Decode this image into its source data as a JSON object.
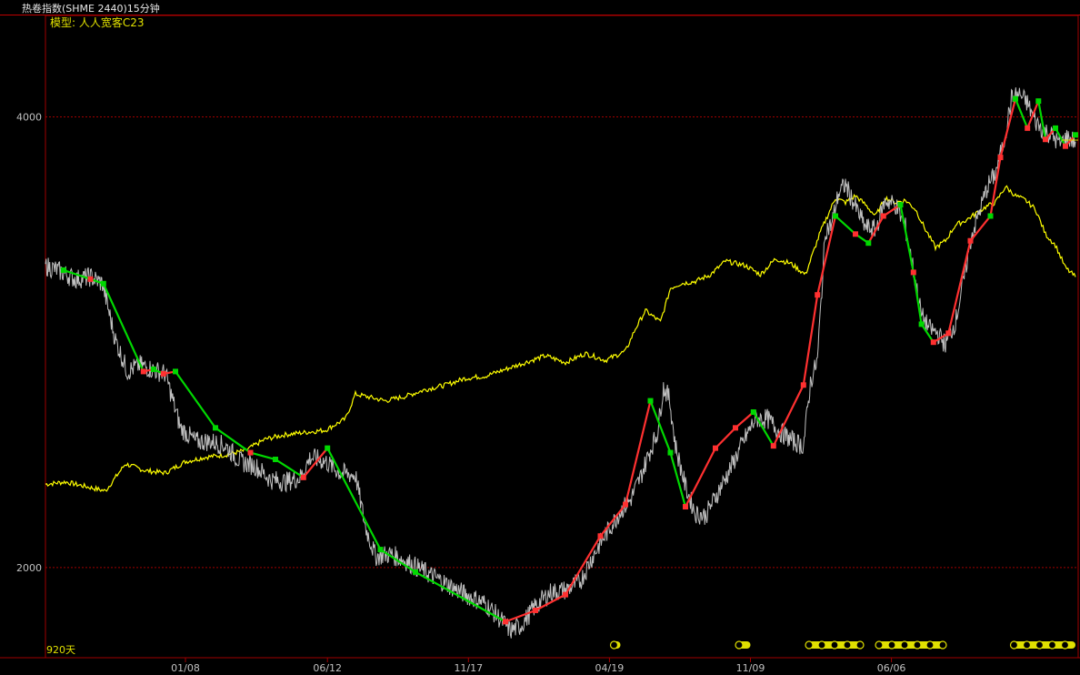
{
  "window": {
    "title": "热卷指数(SHME 2440)15分钟"
  },
  "model_label": "模型: 人人宽客C23",
  "period_label": "920天",
  "colors": {
    "price": "#c0c0c0",
    "equity": "#ffff00",
    "up_segment": "#ff3030",
    "down_segment": "#00d800",
    "grid": "#a00000",
    "axis_text": "#c0c0c0",
    "marker_fill": "#e0e000"
  },
  "chart_data": {
    "type": "line",
    "x_tick_labels": [
      "01/08",
      "06/12",
      "11/17",
      "04/19",
      "11/09",
      "06/06"
    ],
    "y_ticks": [
      4000,
      2000
    ],
    "ylim": [
      1600,
      4450
    ],
    "grid": true,
    "series": [
      {
        "role": "price",
        "points": [
          [
            0.0,
            3340
          ],
          [
            0.012,
            3320
          ],
          [
            0.03,
            3280
          ],
          [
            0.045,
            3290
          ],
          [
            0.057,
            3260
          ],
          [
            0.07,
            3010
          ],
          [
            0.082,
            2870
          ],
          [
            0.094,
            2900
          ],
          [
            0.106,
            2880
          ],
          [
            0.12,
            2860
          ],
          [
            0.135,
            2620
          ],
          [
            0.15,
            2560
          ],
          [
            0.165,
            2560
          ],
          [
            0.18,
            2540
          ],
          [
            0.195,
            2470
          ],
          [
            0.21,
            2450
          ],
          [
            0.225,
            2390
          ],
          [
            0.24,
            2380
          ],
          [
            0.255,
            2400
          ],
          [
            0.265,
            2490
          ],
          [
            0.28,
            2470
          ],
          [
            0.295,
            2420
          ],
          [
            0.31,
            2410
          ],
          [
            0.32,
            2180
          ],
          [
            0.33,
            2050
          ],
          [
            0.345,
            2060
          ],
          [
            0.36,
            2030
          ],
          [
            0.38,
            1980
          ],
          [
            0.4,
            1930
          ],
          [
            0.42,
            1880
          ],
          [
            0.44,
            1840
          ],
          [
            0.455,
            1770
          ],
          [
            0.465,
            1720
          ],
          [
            0.475,
            1740
          ],
          [
            0.49,
            1830
          ],
          [
            0.505,
            1890
          ],
          [
            0.52,
            1900
          ],
          [
            0.535,
            1940
          ],
          [
            0.545,
            2030
          ],
          [
            0.555,
            2110
          ],
          [
            0.565,
            2180
          ],
          [
            0.575,
            2250
          ],
          [
            0.585,
            2300
          ],
          [
            0.595,
            2400
          ],
          [
            0.603,
            2500
          ],
          [
            0.612,
            2600
          ],
          [
            0.618,
            2800
          ],
          [
            0.624,
            2750
          ],
          [
            0.63,
            2540
          ],
          [
            0.64,
            2360
          ],
          [
            0.65,
            2240
          ],
          [
            0.66,
            2230
          ],
          [
            0.672,
            2330
          ],
          [
            0.685,
            2440
          ],
          [
            0.698,
            2560
          ],
          [
            0.71,
            2660
          ],
          [
            0.722,
            2660
          ],
          [
            0.735,
            2600
          ],
          [
            0.748,
            2560
          ],
          [
            0.758,
            2540
          ],
          [
            0.765,
            2820
          ],
          [
            0.772,
            2920
          ],
          [
            0.78,
            3500
          ],
          [
            0.786,
            3520
          ],
          [
            0.793,
            3660
          ],
          [
            0.8,
            3700
          ],
          [
            0.81,
            3600
          ],
          [
            0.82,
            3510
          ],
          [
            0.83,
            3500
          ],
          [
            0.84,
            3630
          ],
          [
            0.85,
            3610
          ],
          [
            0.86,
            3510
          ],
          [
            0.868,
            3320
          ],
          [
            0.876,
            3120
          ],
          [
            0.884,
            3060
          ],
          [
            0.892,
            3040
          ],
          [
            0.9,
            2990
          ],
          [
            0.91,
            3090
          ],
          [
            0.918,
            3270
          ],
          [
            0.926,
            3470
          ],
          [
            0.934,
            3580
          ],
          [
            0.942,
            3690
          ],
          [
            0.95,
            3750
          ],
          [
            0.958,
            3880
          ],
          [
            0.966,
            4080
          ],
          [
            0.974,
            4100
          ],
          [
            0.982,
            4060
          ],
          [
            0.99,
            3980
          ],
          [
            0.998,
            3940
          ],
          [
            1.006,
            3920
          ],
          [
            1.014,
            3880
          ],
          [
            1.022,
            3910
          ],
          [
            1.03,
            3890
          ]
        ]
      },
      {
        "role": "equity",
        "points": [
          [
            0.0,
            2370
          ],
          [
            0.02,
            2380
          ],
          [
            0.04,
            2360
          ],
          [
            0.06,
            2340
          ],
          [
            0.08,
            2460
          ],
          [
            0.1,
            2430
          ],
          [
            0.12,
            2420
          ],
          [
            0.14,
            2470
          ],
          [
            0.16,
            2490
          ],
          [
            0.18,
            2500
          ],
          [
            0.2,
            2520
          ],
          [
            0.22,
            2570
          ],
          [
            0.24,
            2590
          ],
          [
            0.26,
            2600
          ],
          [
            0.28,
            2610
          ],
          [
            0.3,
            2660
          ],
          [
            0.31,
            2770
          ],
          [
            0.32,
            2760
          ],
          [
            0.34,
            2740
          ],
          [
            0.36,
            2760
          ],
          [
            0.38,
            2790
          ],
          [
            0.4,
            2810
          ],
          [
            0.42,
            2840
          ],
          [
            0.44,
            2850
          ],
          [
            0.46,
            2880
          ],
          [
            0.48,
            2910
          ],
          [
            0.5,
            2940
          ],
          [
            0.52,
            2910
          ],
          [
            0.54,
            2950
          ],
          [
            0.56,
            2920
          ],
          [
            0.58,
            2960
          ],
          [
            0.59,
            3060
          ],
          [
            0.6,
            3140
          ],
          [
            0.615,
            3090
          ],
          [
            0.625,
            3240
          ],
          [
            0.635,
            3260
          ],
          [
            0.65,
            3270
          ],
          [
            0.665,
            3300
          ],
          [
            0.68,
            3360
          ],
          [
            0.7,
            3340
          ],
          [
            0.715,
            3300
          ],
          [
            0.73,
            3370
          ],
          [
            0.745,
            3350
          ],
          [
            0.76,
            3300
          ],
          [
            0.775,
            3490
          ],
          [
            0.79,
            3640
          ],
          [
            0.8,
            3620
          ],
          [
            0.81,
            3650
          ],
          [
            0.82,
            3610
          ],
          [
            0.83,
            3560
          ],
          [
            0.84,
            3640
          ],
          [
            0.85,
            3620
          ],
          [
            0.86,
            3630
          ],
          [
            0.87,
            3590
          ],
          [
            0.88,
            3500
          ],
          [
            0.89,
            3420
          ],
          [
            0.9,
            3450
          ],
          [
            0.91,
            3520
          ],
          [
            0.92,
            3540
          ],
          [
            0.93,
            3570
          ],
          [
            0.94,
            3600
          ],
          [
            0.95,
            3620
          ],
          [
            0.96,
            3690
          ],
          [
            0.97,
            3650
          ],
          [
            0.98,
            3630
          ],
          [
            0.99,
            3590
          ],
          [
            1.0,
            3480
          ],
          [
            1.01,
            3430
          ],
          [
            1.02,
            3330
          ],
          [
            1.03,
            3290
          ]
        ]
      },
      {
        "role": "signal_segments",
        "points": [
          [
            0.018,
            3320,
            "d"
          ],
          [
            0.045,
            3280,
            "u"
          ],
          [
            0.058,
            3260,
            "d"
          ],
          [
            0.098,
            2870,
            "u"
          ],
          [
            0.108,
            2880,
            "d"
          ],
          [
            0.118,
            2860,
            "u"
          ],
          [
            0.13,
            2870,
            "d"
          ],
          [
            0.17,
            2620,
            "d"
          ],
          [
            0.205,
            2510,
            "u"
          ],
          [
            0.23,
            2480,
            "d"
          ],
          [
            0.258,
            2400,
            "u"
          ],
          [
            0.282,
            2530,
            "d"
          ],
          [
            0.335,
            2080,
            "d"
          ],
          [
            0.37,
            1980,
            "d"
          ],
          [
            0.46,
            1760,
            "u"
          ],
          [
            0.49,
            1810,
            "u"
          ],
          [
            0.52,
            1880,
            "u"
          ],
          [
            0.555,
            2140,
            "u"
          ],
          [
            0.58,
            2280,
            "u"
          ],
          [
            0.605,
            2740,
            "d"
          ],
          [
            0.625,
            2510,
            "d"
          ],
          [
            0.64,
            2270,
            "u"
          ],
          [
            0.67,
            2530,
            "u"
          ],
          [
            0.69,
            2620,
            "u"
          ],
          [
            0.708,
            2690,
            "d"
          ],
          [
            0.728,
            2540,
            "u"
          ],
          [
            0.758,
            2810,
            "u"
          ],
          [
            0.772,
            3210,
            "u"
          ],
          [
            0.79,
            3560,
            "d"
          ],
          [
            0.81,
            3480,
            "u"
          ],
          [
            0.823,
            3440,
            "d"
          ],
          [
            0.838,
            3560,
            "u"
          ],
          [
            0.855,
            3610,
            "d"
          ],
          [
            0.868,
            3310,
            "u"
          ],
          [
            0.876,
            3080,
            "d"
          ],
          [
            0.888,
            3000,
            "u"
          ],
          [
            0.903,
            3040,
            "u"
          ],
          [
            0.925,
            3450,
            "u"
          ],
          [
            0.945,
            3560,
            "d"
          ],
          [
            0.955,
            3820,
            "u"
          ],
          [
            0.97,
            4080,
            "d"
          ],
          [
            0.982,
            3950,
            "u"
          ],
          [
            0.993,
            4070,
            "d"
          ],
          [
            1.0,
            3900,
            "u"
          ],
          [
            1.01,
            3950,
            "d"
          ],
          [
            1.02,
            3870,
            "u"
          ],
          [
            1.03,
            3920,
            "d"
          ]
        ]
      }
    ],
    "bottom_markers": [
      {
        "start": 0.565,
        "end": 0.575
      },
      {
        "start": 0.69,
        "end": 0.705
      },
      {
        "start": 0.76,
        "end": 0.815
      },
      {
        "start": 0.83,
        "end": 0.9
      },
      {
        "start": 0.965,
        "end": 1.03
      }
    ]
  }
}
